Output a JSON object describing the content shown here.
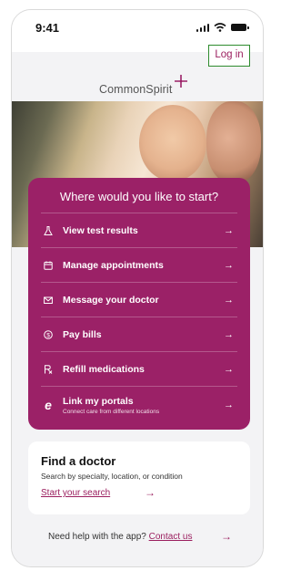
{
  "status_bar": {
    "time": "9:41"
  },
  "header": {
    "login_label": "Log in",
    "logo_text": "CommonSpirit"
  },
  "start_card": {
    "title": "Where would you like to start?",
    "items": [
      {
        "label": "View test results",
        "icon": "flask-icon"
      },
      {
        "label": "Manage appointments",
        "icon": "calendar-icon"
      },
      {
        "label": "Message your doctor",
        "icon": "envelope-icon"
      },
      {
        "label": "Pay bills",
        "icon": "dollar-icon"
      },
      {
        "label": "Refill medications",
        "icon": "prescription-icon"
      },
      {
        "label": "Link my portals",
        "sublabel": "Connect care from different locations",
        "icon": "link-e-icon"
      }
    ]
  },
  "find_doctor": {
    "title": "Find a doctor",
    "subtitle": "Search by specialty, location, or condition",
    "link": "Start your search"
  },
  "help": {
    "text": "Need help with the app?",
    "link": "Contact us"
  },
  "colors": {
    "brand": "#9b2167",
    "link": "#9b1f5f",
    "highlight_border": "#2e8b2e"
  }
}
